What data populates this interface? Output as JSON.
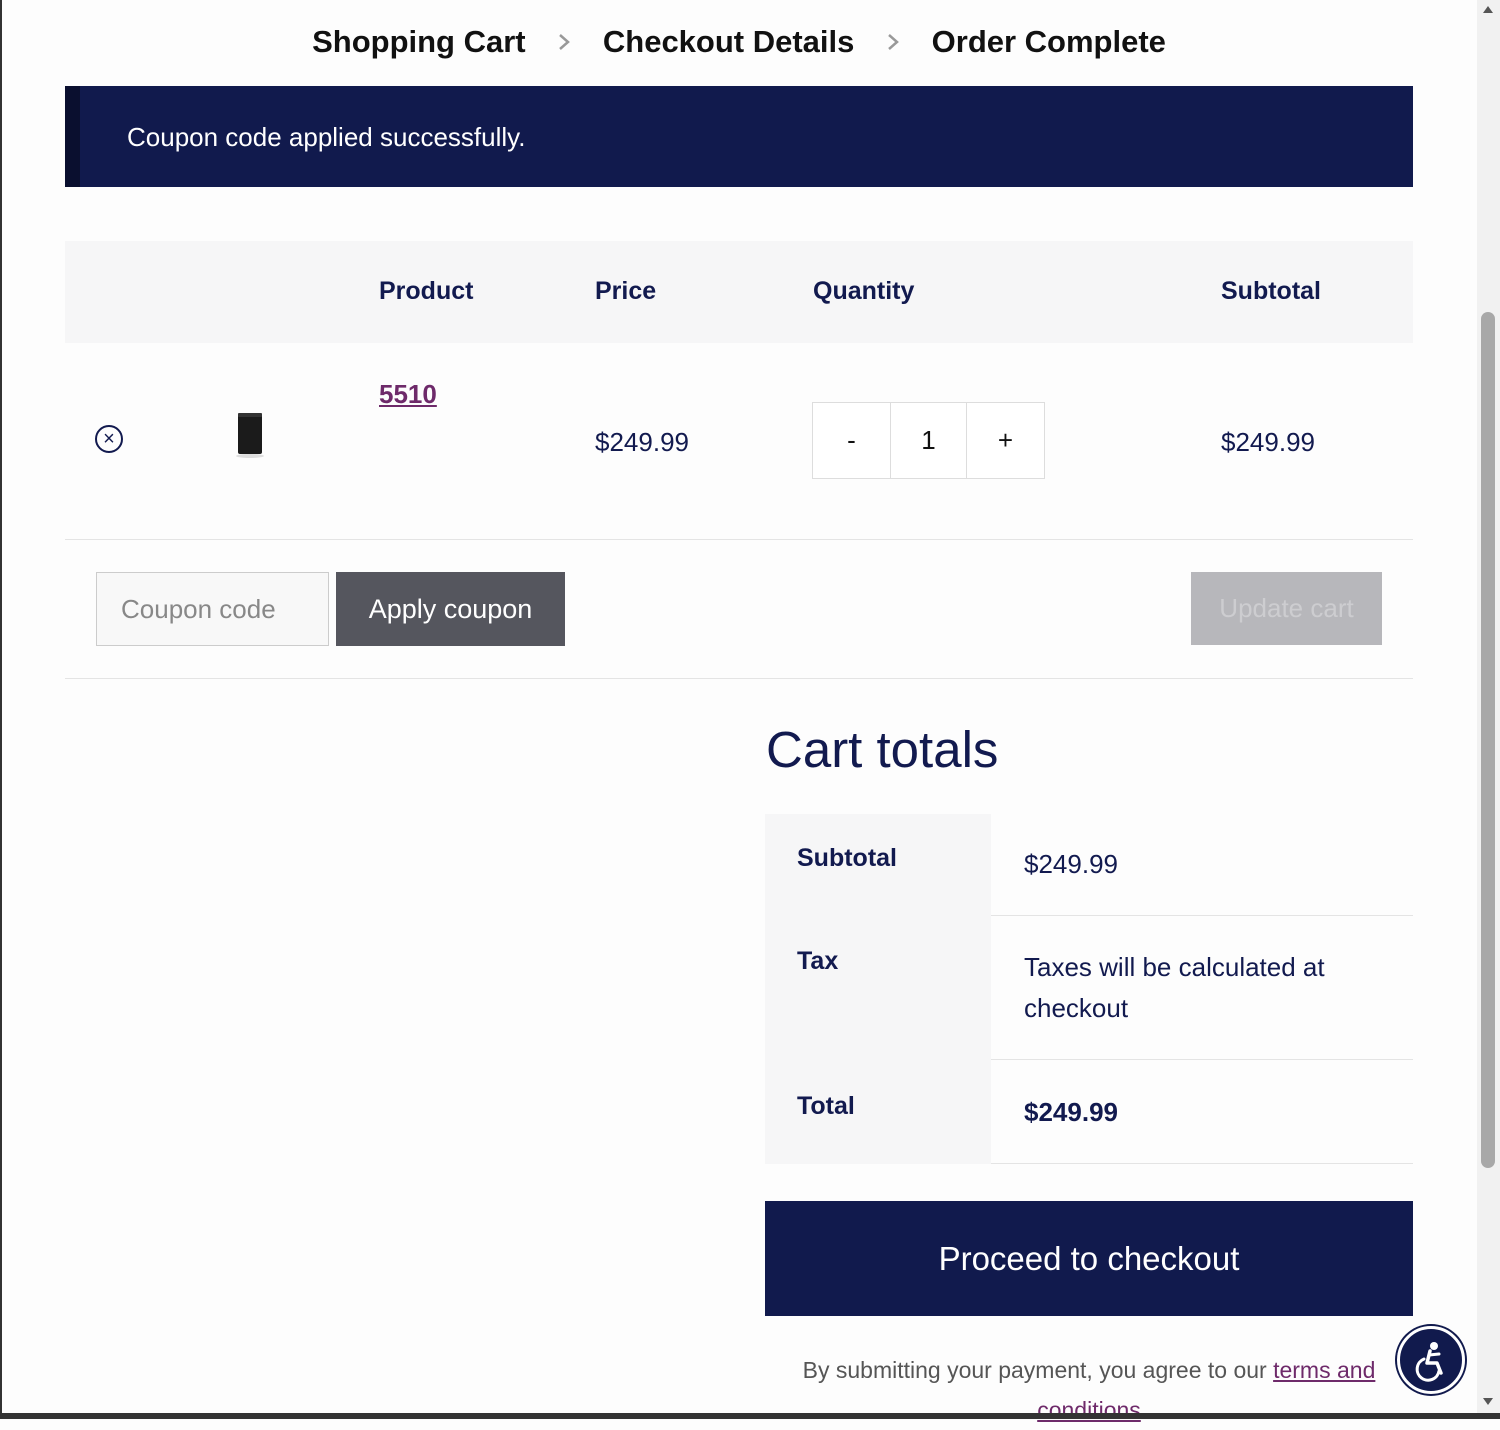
{
  "breadcrumb": {
    "steps": [
      "Shopping Cart",
      "Checkout Details",
      "Order Complete"
    ]
  },
  "notice": {
    "message": "Coupon code applied successfully."
  },
  "cart_table": {
    "headers": [
      "Product",
      "Price",
      "Quantity",
      "Subtotal"
    ],
    "rows": [
      {
        "product": "5510",
        "price": "$249.99",
        "quantity_minus": "-",
        "quantity": "1",
        "quantity_plus": "+",
        "subtotal": "$249.99"
      }
    ],
    "remove_icon": "×"
  },
  "actions": {
    "coupon_placeholder": "Coupon code",
    "apply_label": "Apply coupon",
    "update_label": "Update cart"
  },
  "totals": {
    "title": "Cart totals",
    "subtotal_label": "Subtotal",
    "subtotal_value": "$249.99",
    "tax_label": "Tax",
    "tax_value": "Taxes will be calculated at checkout",
    "total_label": "Total",
    "total_value": "$249.99",
    "checkout_label": "Proceed to checkout"
  },
  "terms": {
    "prefix": "By submitting your payment, you agree to our ",
    "link": "terms and conditions"
  },
  "colors": {
    "brand": "#111a4d",
    "link": "#6e2a6a",
    "apply_button": "#55565e",
    "update_button": "#b7b7bb"
  },
  "icons": [
    "chevron-right-icon",
    "remove-icon",
    "accessibility-icon"
  ]
}
